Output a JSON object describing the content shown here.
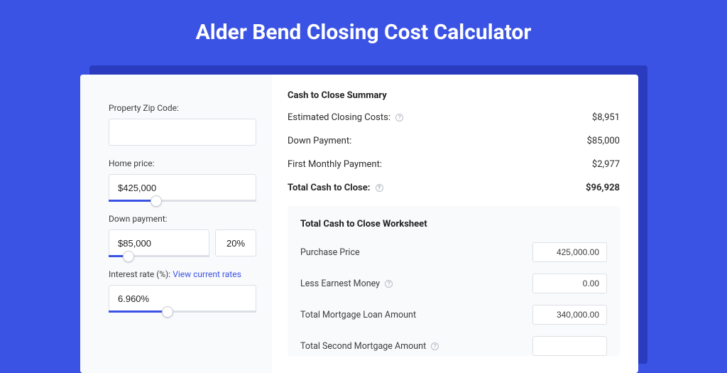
{
  "title": "Alder Bend Closing Cost Calculator",
  "form": {
    "zip_label": "Property Zip Code:",
    "zip_value": "",
    "home_price_label": "Home price:",
    "home_price_value": "$425,000",
    "home_price_slider_pct": 32,
    "down_payment_label": "Down payment:",
    "down_payment_value": "$85,000",
    "down_payment_slider_pct": 20,
    "down_payment_pct_value": "20%",
    "interest_label": "Interest rate (%):",
    "interest_link": "View current rates",
    "interest_value": "6.960%",
    "interest_slider_pct": 40
  },
  "summary": {
    "title": "Cash to Close Summary",
    "rows": [
      {
        "label": "Estimated Closing Costs:",
        "value": "$8,951",
        "help": true
      },
      {
        "label": "Down Payment:",
        "value": "$85,000",
        "help": false
      },
      {
        "label": "First Monthly Payment:",
        "value": "$2,977",
        "help": false
      }
    ],
    "total_label": "Total Cash to Close:",
    "total_value": "$96,928"
  },
  "worksheet": {
    "title": "Total Cash to Close Worksheet",
    "rows": [
      {
        "label": "Purchase Price",
        "value": "425,000.00",
        "help": false
      },
      {
        "label": "Less Earnest Money",
        "value": "0.00",
        "help": true
      },
      {
        "label": "Total Mortgage Loan Amount",
        "value": "340,000.00",
        "help": false
      },
      {
        "label": "Total Second Mortgage Amount",
        "value": "",
        "help": true
      }
    ]
  }
}
